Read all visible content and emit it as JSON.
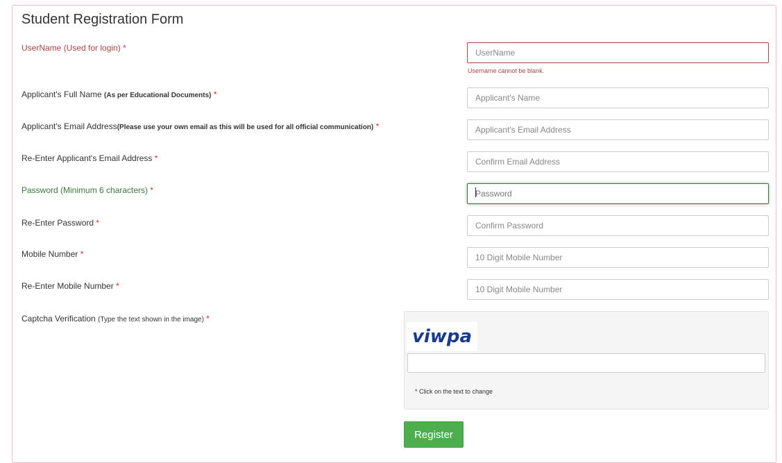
{
  "form": {
    "title": "Student Registration Form",
    "fields": [
      {
        "label": "UserName (Used for login)",
        "note": "",
        "required": "*",
        "placeholder": "UserName",
        "error": "Username cannot be blank."
      },
      {
        "label": "Applicant's Full Name",
        "note": "(As per Educational Documents)",
        "required": "*",
        "placeholder": "Applicant's Name"
      },
      {
        "label": "Applicant's Email Address",
        "note": "(Please use your own email as this will be used for all official communication)",
        "required": "*",
        "placeholder": "Applicant's Email Address"
      },
      {
        "label": "Re-Enter Applicant's Email Address",
        "note": "",
        "required": "*",
        "placeholder": "Confirm Email Address"
      },
      {
        "label": "Password (Minimum 6 characters)",
        "note": "",
        "required": "*",
        "placeholder": "Password"
      },
      {
        "label": "Re-Enter Password",
        "note": "",
        "required": "*",
        "placeholder": "Confirm Password"
      },
      {
        "label": "Mobile Number",
        "note": "",
        "required": "*",
        "placeholder": "10 Digit Mobile Number"
      },
      {
        "label": "Re-Enter Mobile Number",
        "note": "",
        "required": "*",
        "placeholder": "10 Digit Mobile Number"
      }
    ],
    "captcha": {
      "label": "Captcha Verification",
      "note": "(Type the text shown in the image)",
      "required": "*",
      "image_text": "viwpa",
      "value": "",
      "hint": "* Click on the text to change"
    },
    "register_label": "Register"
  },
  "colors": {
    "error": "#a94442",
    "success": "#3c763d",
    "button": "#4cae4c",
    "panel_border": "#f2b8c6",
    "captcha_text": "#1a3a8c"
  }
}
